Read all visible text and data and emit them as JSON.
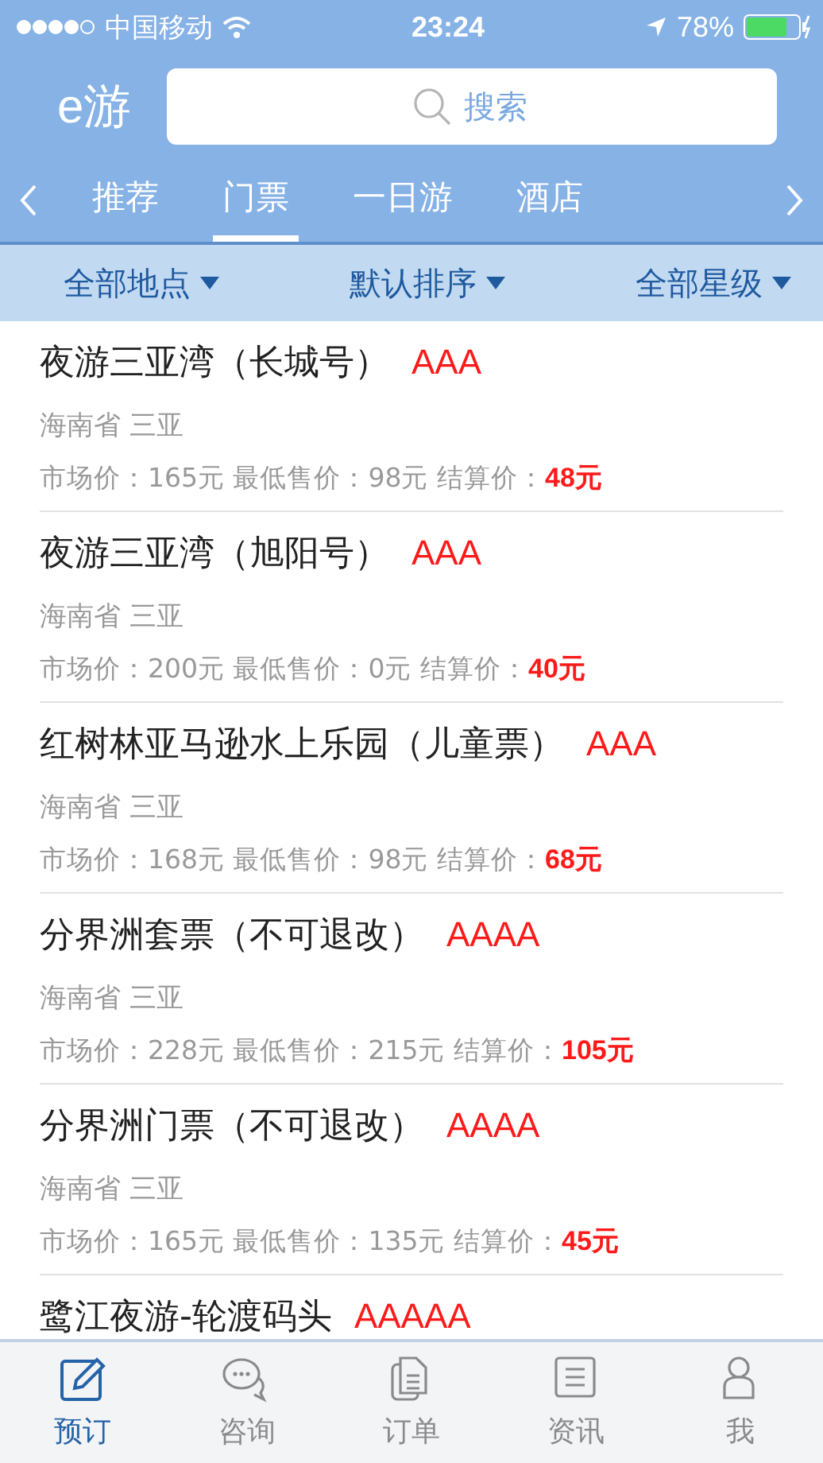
{
  "status_bar": {
    "carrier": "中国移动",
    "time": "23:24",
    "battery": "78%"
  },
  "header": {
    "logo": "e游",
    "search": {
      "placeholder": "搜索"
    }
  },
  "tabs": [
    {
      "label": "推荐",
      "selected": false
    },
    {
      "label": "门票",
      "selected": true
    },
    {
      "label": "一日游",
      "selected": false
    },
    {
      "label": "酒店",
      "selected": false
    }
  ],
  "filters": [
    "全部地点",
    "默认排序",
    "全部星级"
  ],
  "items": [
    {
      "name": "夜游三亚湾（长城号）",
      "grade": "AAA",
      "location": "海南省 三亚",
      "prices": "市场价：165元 最低售价：98元 结算价：",
      "settle": "48元"
    },
    {
      "name": "夜游三亚湾（旭阳号）",
      "grade": "AAA",
      "location": "海南省 三亚",
      "prices": "市场价：200元 最低售价：0元 结算价：",
      "settle": "40元"
    },
    {
      "name": "红树林亚马逊水上乐园（儿童票）",
      "grade": "AAA",
      "location": "海南省 三亚",
      "prices": "市场价：168元 最低售价：98元 结算价：",
      "settle": "68元"
    },
    {
      "name": "分界洲套票（不可退改）",
      "grade": "AAAA",
      "location": "海南省 三亚",
      "prices": "市场价：228元 最低售价：215元 结算价：",
      "settle": "105元"
    },
    {
      "name": "分界洲门票（不可退改）",
      "grade": "AAAA",
      "location": "海南省 三亚",
      "prices": "市场价：165元 最低售价：135元 结算价：",
      "settle": "45元"
    },
    {
      "name": "鹭江夜游-轮渡码头",
      "grade": "AAAAA"
    }
  ],
  "tab_bar": [
    {
      "label": "预订",
      "kind": "edit",
      "selected": true
    },
    {
      "label": "咨询",
      "kind": "chat",
      "selected": false
    },
    {
      "label": "订单",
      "kind": "docs",
      "selected": false
    },
    {
      "label": "资讯",
      "kind": "list",
      "selected": false
    },
    {
      "label": "我",
      "kind": "user",
      "selected": false
    }
  ]
}
